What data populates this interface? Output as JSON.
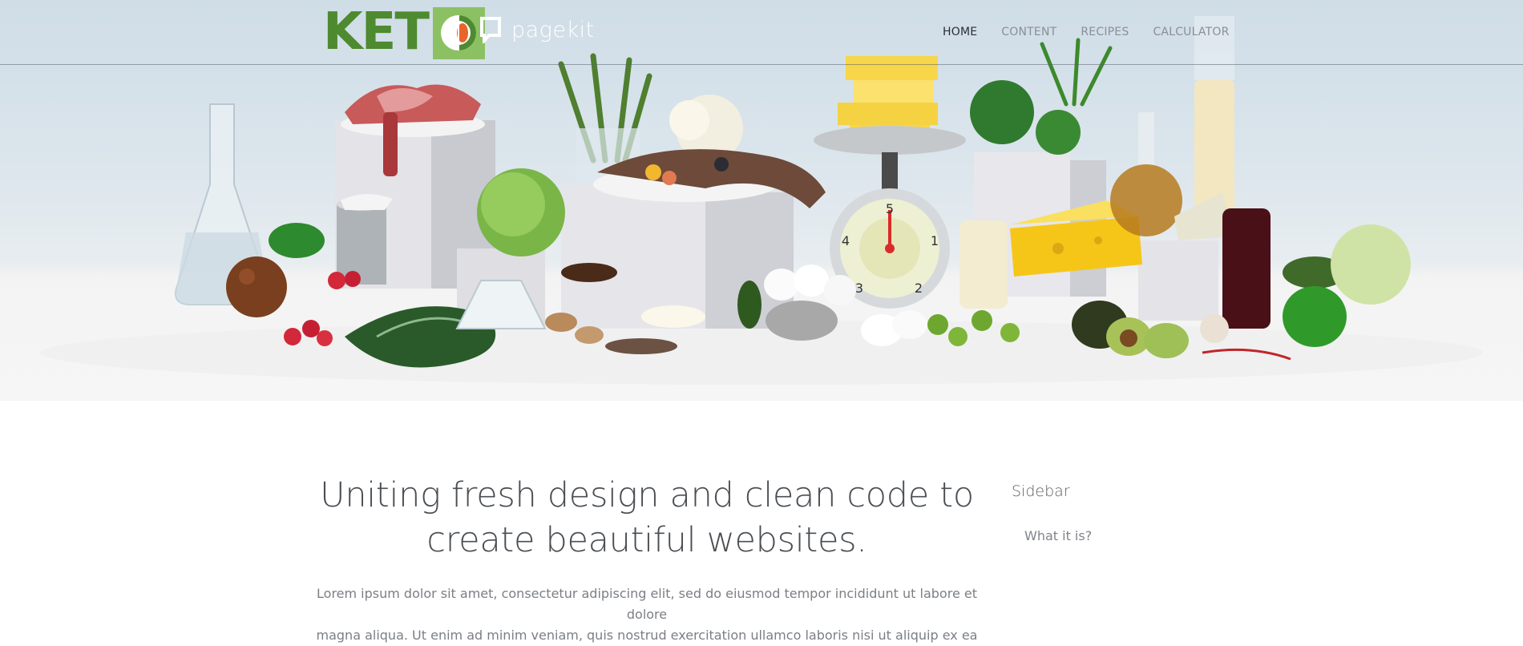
{
  "brand": {
    "logo_text": "KET",
    "logo_o_letter": "O",
    "cms_name": "pagekit"
  },
  "nav": {
    "items": [
      {
        "label": "HOME",
        "active": true
      },
      {
        "label": "CONTENT",
        "active": false
      },
      {
        "label": "RECIPES",
        "active": false
      },
      {
        "label": "CALCULATOR",
        "active": false
      }
    ]
  },
  "hero": {
    "scale_numbers": [
      "5",
      "4",
      "3",
      "2",
      "1"
    ]
  },
  "main": {
    "headline_line1": "Uniting fresh design and clean code to",
    "headline_line2": "create beautiful websites.",
    "lead_line1": "Lorem ipsum dolor sit amet, consectetur adipiscing elit, sed do eiusmod tempor incididunt ut labore et dolore",
    "lead_line2": "magna aliqua. Ut enim ad minim veniam, quis nostrud exercitation ullamco laboris nisi ut aliquip ex ea"
  },
  "sidebar": {
    "title": "Sidebar",
    "links": [
      {
        "label": "What it is?"
      }
    ]
  },
  "colors": {
    "logo_green": "#4e8a2f",
    "logo_box_green": "#8cc163",
    "logo_orange": "#e8652a",
    "nav_active": "#2b2f33",
    "nav_inactive": "#8a8f95",
    "text_heading": "#4a4e53",
    "text_body": "#7b7f84"
  }
}
